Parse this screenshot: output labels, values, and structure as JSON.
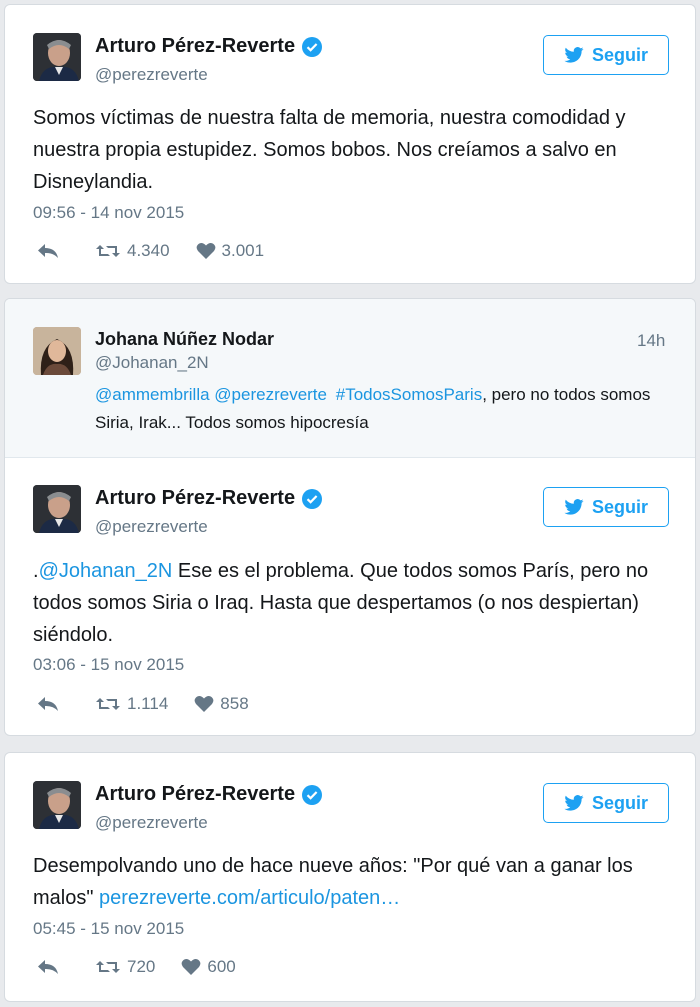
{
  "colors": {
    "accent": "#1da1f2",
    "link": "#1b95e0",
    "muted": "#657786",
    "verified": "#1da1f2"
  },
  "tweets": [
    {
      "name": "Arturo Pérez-Reverte",
      "handle": "@perezreverte",
      "follow_label": "Seguir",
      "text": "Somos víctimas de nuestra falta de memoria, nuestra comodidad y nuestra propia estupidez. Somos bobos. Nos creíamos a salvo en Disneylandia.",
      "time": "09:56 - 14 nov 2015",
      "retweets": "4.340",
      "likes": "3.001"
    },
    {
      "reply_to": {
        "name": "Johana Núñez Nodar",
        "handle": "@Johanan_2N",
        "age": "14h",
        "mention1": "@ammembrilla",
        "mention2": "@perezreverte",
        "hashtag": "#TodosSomosParis",
        "text": ",  pero no todos somos Siria, Irak... Todos somos hipocresía"
      },
      "name": "Arturo Pérez-Reverte",
      "handle": "@perezreverte",
      "follow_label": "Seguir",
      "text_prefix": ".",
      "mention": "@Johanan_2N",
      "text": " Ese es el problema. Que todos somos París, pero no todos somos Siria o Iraq. Hasta que despertamos (o nos despiertan) siéndolo.",
      "time": "03:06 - 15 nov 2015",
      "retweets": "1.114",
      "likes": "858"
    },
    {
      "name": "Arturo Pérez-Reverte",
      "handle": "@perezreverte",
      "follow_label": "Seguir",
      "text": "Desempolvando uno de hace nueve años: \"Por qué van a ganar los malos\" ",
      "link": "perezreverte.com/articulo/paten…",
      "time": "05:45 - 15 nov 2015",
      "retweets": "720",
      "likes": "600"
    }
  ]
}
